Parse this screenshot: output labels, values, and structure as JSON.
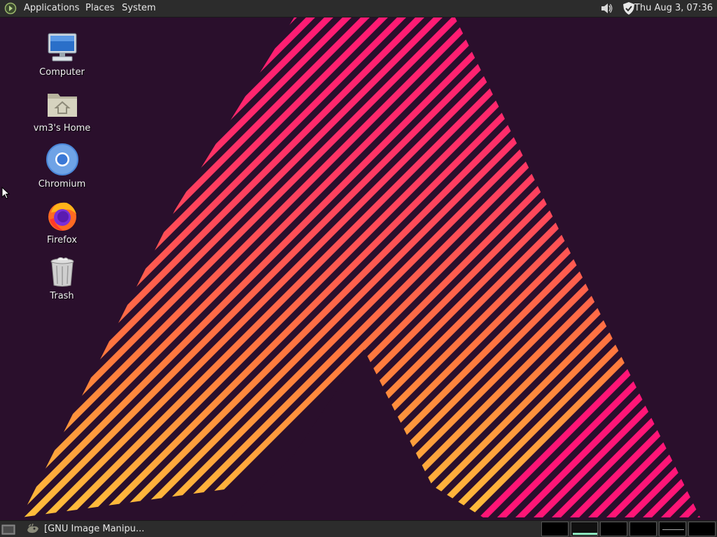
{
  "top_panel": {
    "menus": [
      "Applications",
      "Places",
      "System"
    ],
    "tray_icons": [
      "speaker-icon",
      "shield-icon"
    ],
    "clock": "Thu Aug  3, 07:36"
  },
  "desktop_icons": [
    {
      "label": "Computer",
      "icon": "computer-icon"
    },
    {
      "label": "vm3's Home",
      "icon": "home-folder-icon"
    },
    {
      "label": "Chromium",
      "icon": "chromium-icon"
    },
    {
      "label": "Firefox",
      "icon": "firefox-icon"
    },
    {
      "label": "Trash",
      "icon": "trash-icon"
    }
  ],
  "bottom_panel": {
    "task_label": "[GNU Image Manipu...",
    "task_icon": "gimp-icon",
    "workspaces_count": 6,
    "active_workspace": 2
  },
  "colors": {
    "panel": "#2c2c2c",
    "background": "#2a0f2c",
    "stripe_pink": "#ff1577",
    "stripe_orange": "#ff7a3d",
    "stripe_yellow": "#ffc83a",
    "workspace_accent": "#8de8c0"
  }
}
